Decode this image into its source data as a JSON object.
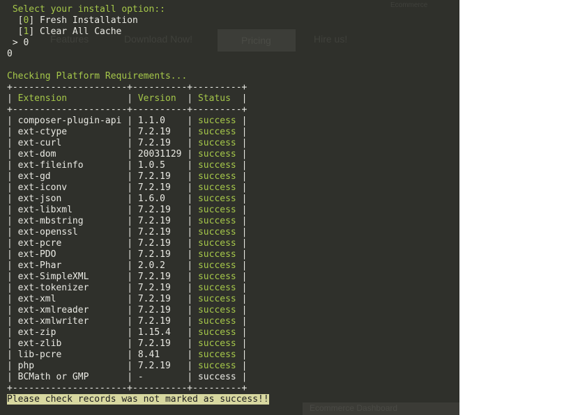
{
  "ghost_page": {
    "link_1": "Features",
    "link_2": "Download Now!",
    "button": "Pricing",
    "link_3": "Hire us!",
    "corner": "Ecommerce",
    "bottom_bar": "Ecommerce Dashboard"
  },
  "prompt": {
    "question": "Select your install option::",
    "options": [
      {
        "key": "0",
        "label": "Fresh Installation"
      },
      {
        "key": "1",
        "label": "Clear All Cache"
      }
    ],
    "answer_prefix": " > ",
    "answer": "0",
    "echo": "0"
  },
  "check": {
    "heading": "Checking Platform Requirements...",
    "headers": {
      "extension": "Extension",
      "version": "Version",
      "status": "Status"
    },
    "rows": [
      {
        "extension": "composer-plugin-api",
        "version": "1.1.0",
        "status": "success"
      },
      {
        "extension": "ext-ctype",
        "version": "7.2.19",
        "status": "success"
      },
      {
        "extension": "ext-curl",
        "version": "7.2.19",
        "status": "success"
      },
      {
        "extension": "ext-dom",
        "version": "20031129",
        "status": "success"
      },
      {
        "extension": "ext-fileinfo",
        "version": "1.0.5",
        "status": "success"
      },
      {
        "extension": "ext-gd",
        "version": "7.2.19",
        "status": "success"
      },
      {
        "extension": "ext-iconv",
        "version": "7.2.19",
        "status": "success"
      },
      {
        "extension": "ext-json",
        "version": "1.6.0",
        "status": "success"
      },
      {
        "extension": "ext-libxml",
        "version": "7.2.19",
        "status": "success"
      },
      {
        "extension": "ext-mbstring",
        "version": "7.2.19",
        "status": "success"
      },
      {
        "extension": "ext-openssl",
        "version": "7.2.19",
        "status": "success"
      },
      {
        "extension": "ext-pcre",
        "version": "7.2.19",
        "status": "success"
      },
      {
        "extension": "ext-PDO",
        "version": "7.2.19",
        "status": "success"
      },
      {
        "extension": "ext-Phar",
        "version": "2.0.2",
        "status": "success"
      },
      {
        "extension": "ext-SimpleXML",
        "version": "7.2.19",
        "status": "success"
      },
      {
        "extension": "ext-tokenizer",
        "version": "7.2.19",
        "status": "success"
      },
      {
        "extension": "ext-xml",
        "version": "7.2.19",
        "status": "success"
      },
      {
        "extension": "ext-xmlreader",
        "version": "7.2.19",
        "status": "success"
      },
      {
        "extension": "ext-xmlwriter",
        "version": "7.2.19",
        "status": "success"
      },
      {
        "extension": "ext-zip",
        "version": "1.15.4",
        "status": "success"
      },
      {
        "extension": "ext-zlib",
        "version": "7.2.19",
        "status": "success"
      },
      {
        "extension": "lib-pcre",
        "version": "8.41",
        "status": "success"
      },
      {
        "extension": "php",
        "version": "7.2.19",
        "status": "success"
      },
      {
        "extension": "BCMath or GMP",
        "version": "-",
        "status": "success",
        "status_plain": true
      }
    ],
    "warning": "Please check records was not marked as success!!"
  },
  "colors": {
    "terminal_bg": "#2f302b",
    "text": "#e9e9e3",
    "green": "#a6c84a",
    "warning_bg": "#d8d8a0"
  }
}
